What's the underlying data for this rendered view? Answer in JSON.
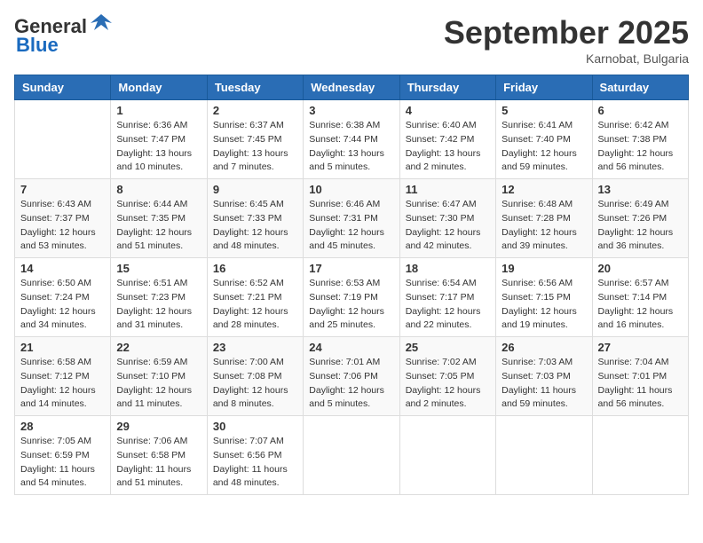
{
  "header": {
    "logo_general": "General",
    "logo_blue": "Blue",
    "month_title": "September 2025",
    "location": "Karnobat, Bulgaria"
  },
  "weekdays": [
    "Sunday",
    "Monday",
    "Tuesday",
    "Wednesday",
    "Thursday",
    "Friday",
    "Saturday"
  ],
  "weeks": [
    [
      {
        "day": "",
        "info": ""
      },
      {
        "day": "1",
        "info": "Sunrise: 6:36 AM\nSunset: 7:47 PM\nDaylight: 13 hours\nand 10 minutes."
      },
      {
        "day": "2",
        "info": "Sunrise: 6:37 AM\nSunset: 7:45 PM\nDaylight: 13 hours\nand 7 minutes."
      },
      {
        "day": "3",
        "info": "Sunrise: 6:38 AM\nSunset: 7:44 PM\nDaylight: 13 hours\nand 5 minutes."
      },
      {
        "day": "4",
        "info": "Sunrise: 6:40 AM\nSunset: 7:42 PM\nDaylight: 13 hours\nand 2 minutes."
      },
      {
        "day": "5",
        "info": "Sunrise: 6:41 AM\nSunset: 7:40 PM\nDaylight: 12 hours\nand 59 minutes."
      },
      {
        "day": "6",
        "info": "Sunrise: 6:42 AM\nSunset: 7:38 PM\nDaylight: 12 hours\nand 56 minutes."
      }
    ],
    [
      {
        "day": "7",
        "info": "Sunrise: 6:43 AM\nSunset: 7:37 PM\nDaylight: 12 hours\nand 53 minutes."
      },
      {
        "day": "8",
        "info": "Sunrise: 6:44 AM\nSunset: 7:35 PM\nDaylight: 12 hours\nand 51 minutes."
      },
      {
        "day": "9",
        "info": "Sunrise: 6:45 AM\nSunset: 7:33 PM\nDaylight: 12 hours\nand 48 minutes."
      },
      {
        "day": "10",
        "info": "Sunrise: 6:46 AM\nSunset: 7:31 PM\nDaylight: 12 hours\nand 45 minutes."
      },
      {
        "day": "11",
        "info": "Sunrise: 6:47 AM\nSunset: 7:30 PM\nDaylight: 12 hours\nand 42 minutes."
      },
      {
        "day": "12",
        "info": "Sunrise: 6:48 AM\nSunset: 7:28 PM\nDaylight: 12 hours\nand 39 minutes."
      },
      {
        "day": "13",
        "info": "Sunrise: 6:49 AM\nSunset: 7:26 PM\nDaylight: 12 hours\nand 36 minutes."
      }
    ],
    [
      {
        "day": "14",
        "info": "Sunrise: 6:50 AM\nSunset: 7:24 PM\nDaylight: 12 hours\nand 34 minutes."
      },
      {
        "day": "15",
        "info": "Sunrise: 6:51 AM\nSunset: 7:23 PM\nDaylight: 12 hours\nand 31 minutes."
      },
      {
        "day": "16",
        "info": "Sunrise: 6:52 AM\nSunset: 7:21 PM\nDaylight: 12 hours\nand 28 minutes."
      },
      {
        "day": "17",
        "info": "Sunrise: 6:53 AM\nSunset: 7:19 PM\nDaylight: 12 hours\nand 25 minutes."
      },
      {
        "day": "18",
        "info": "Sunrise: 6:54 AM\nSunset: 7:17 PM\nDaylight: 12 hours\nand 22 minutes."
      },
      {
        "day": "19",
        "info": "Sunrise: 6:56 AM\nSunset: 7:15 PM\nDaylight: 12 hours\nand 19 minutes."
      },
      {
        "day": "20",
        "info": "Sunrise: 6:57 AM\nSunset: 7:14 PM\nDaylight: 12 hours\nand 16 minutes."
      }
    ],
    [
      {
        "day": "21",
        "info": "Sunrise: 6:58 AM\nSunset: 7:12 PM\nDaylight: 12 hours\nand 14 minutes."
      },
      {
        "day": "22",
        "info": "Sunrise: 6:59 AM\nSunset: 7:10 PM\nDaylight: 12 hours\nand 11 minutes."
      },
      {
        "day": "23",
        "info": "Sunrise: 7:00 AM\nSunset: 7:08 PM\nDaylight: 12 hours\nand 8 minutes."
      },
      {
        "day": "24",
        "info": "Sunrise: 7:01 AM\nSunset: 7:06 PM\nDaylight: 12 hours\nand 5 minutes."
      },
      {
        "day": "25",
        "info": "Sunrise: 7:02 AM\nSunset: 7:05 PM\nDaylight: 12 hours\nand 2 minutes."
      },
      {
        "day": "26",
        "info": "Sunrise: 7:03 AM\nSunset: 7:03 PM\nDaylight: 11 hours\nand 59 minutes."
      },
      {
        "day": "27",
        "info": "Sunrise: 7:04 AM\nSunset: 7:01 PM\nDaylight: 11 hours\nand 56 minutes."
      }
    ],
    [
      {
        "day": "28",
        "info": "Sunrise: 7:05 AM\nSunset: 6:59 PM\nDaylight: 11 hours\nand 54 minutes."
      },
      {
        "day": "29",
        "info": "Sunrise: 7:06 AM\nSunset: 6:58 PM\nDaylight: 11 hours\nand 51 minutes."
      },
      {
        "day": "30",
        "info": "Sunrise: 7:07 AM\nSunset: 6:56 PM\nDaylight: 11 hours\nand 48 minutes."
      },
      {
        "day": "",
        "info": ""
      },
      {
        "day": "",
        "info": ""
      },
      {
        "day": "",
        "info": ""
      },
      {
        "day": "",
        "info": ""
      }
    ]
  ]
}
